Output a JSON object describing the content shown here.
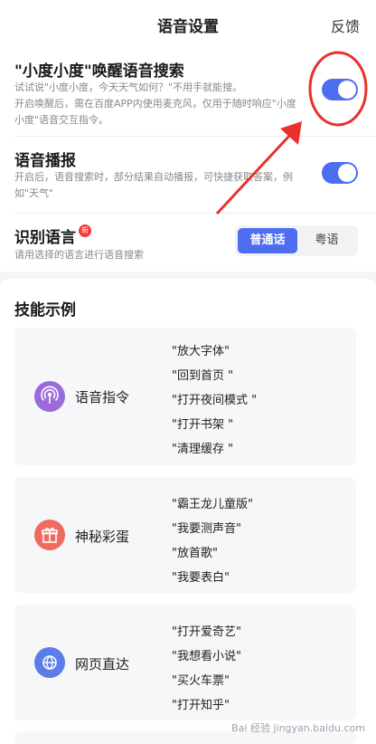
{
  "header": {
    "title": "语音设置",
    "feedback": "反馈"
  },
  "wake": {
    "title": "\"小度小度\"唤醒语音搜索",
    "desc_lines": [
      "试试说\"小度小度，今天天气如何？\"不用手就能搜。",
      "开启唤醒后，需在百度APP内使用麦克风，仅用于随时响应\"小度",
      "小度\"语音交互指令。"
    ],
    "enabled": true
  },
  "broadcast": {
    "title": "语音播报",
    "desc_lines": [
      "开启后，语音搜索时，部分结果自动播报，可快捷获取答案，例",
      "如\"天气\""
    ],
    "enabled": true
  },
  "language": {
    "title": "识别语言",
    "badge": "新",
    "desc": "请用选择的语言进行语音搜索",
    "options": [
      "普通话",
      "粤语"
    ],
    "selected": "普通话"
  },
  "skills": {
    "heading": "技能示例",
    "cards": [
      {
        "label": "语音指令",
        "icon": "broadcast-icon",
        "color": "#9b6bdb",
        "commands": [
          "\"放大字体\"",
          "\"回到首页 \"",
          "\"打开夜间模式 \"",
          "\"打开书架 \"",
          "\"清理缓存 \""
        ]
      },
      {
        "label": "神秘彩蛋",
        "icon": "gift-icon",
        "color": "#ef6b5e",
        "commands": [
          "\"霸王龙儿童版\"",
          "\"我要测声音\"",
          "\"放首歌\"",
          "\"我要表白\""
        ]
      },
      {
        "label": "网页直达",
        "icon": "globe-icon",
        "color": "#5b7de8",
        "commands": [
          "\"打开爱奇艺\"",
          "\"我想看小说\"",
          "\"买火车票\"",
          "\"打开知乎\""
        ]
      }
    ]
  },
  "annotation_color": "#e8312b",
  "watermark": "Bai 经验 jingyan.baidu.com"
}
